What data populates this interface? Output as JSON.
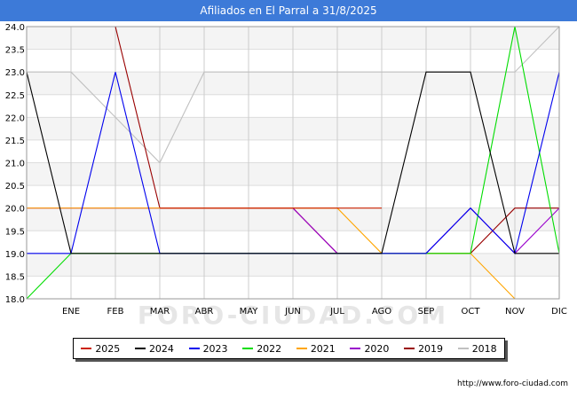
{
  "header": {
    "title": "Afiliados en El Parral a 31/8/2025"
  },
  "footer": {
    "source": "http://www.foro-ciudad.com"
  },
  "watermark": "FORO-CIUDAD.COM",
  "chart_data": {
    "type": "line",
    "title": "Afiliados en El Parral a 31/8/2025",
    "categories": [
      "",
      "ENE",
      "FEB",
      "MAR",
      "ABR",
      "MAY",
      "JUN",
      "JUL",
      "AGO",
      "SEP",
      "OCT",
      "NOV",
      "DIC"
    ],
    "ylim": [
      18.0,
      24.0
    ],
    "yticks": [
      "18.0",
      "18.5",
      "19.0",
      "19.5",
      "20.0",
      "20.5",
      "21.0",
      "21.5",
      "22.0",
      "22.5",
      "23.0",
      "23.5",
      "24.0"
    ],
    "grid": true,
    "legend_position": "bottom",
    "series": [
      {
        "name": "2025",
        "color": "#cc2200",
        "values": [
          null,
          null,
          null,
          20,
          20,
          20,
          20,
          20,
          20,
          null,
          null,
          null,
          null
        ]
      },
      {
        "name": "2024",
        "color": "#000000",
        "values": [
          23,
          19,
          19,
          19,
          19,
          19,
          19,
          19,
          19,
          23,
          23,
          19,
          19
        ]
      },
      {
        "name": "2023",
        "color": "#0000ee",
        "values": [
          19,
          19,
          23,
          19,
          19,
          19,
          19,
          19,
          19,
          19,
          20,
          19,
          23
        ]
      },
      {
        "name": "2022",
        "color": "#00dd00",
        "values": [
          18,
          19,
          19,
          19,
          19,
          19,
          19,
          19,
          19,
          19,
          19,
          24,
          19
        ]
      },
      {
        "name": "2021",
        "color": "#ffa500",
        "values": [
          20,
          20,
          20,
          20,
          20,
          20,
          20,
          20,
          19,
          19,
          19,
          18,
          null
        ]
      },
      {
        "name": "2020",
        "color": "#9900cc",
        "values": [
          20,
          20,
          20,
          20,
          20,
          20,
          20,
          19,
          19,
          19,
          20,
          19,
          20
        ]
      },
      {
        "name": "2019",
        "color": "#990000",
        "values": [
          null,
          null,
          24,
          20,
          20,
          20,
          20,
          19,
          19,
          19,
          19,
          20,
          20
        ]
      },
      {
        "name": "2018",
        "color": "#c0c0c0",
        "values": [
          23,
          23,
          22,
          21,
          23,
          23,
          23,
          23,
          23,
          23,
          23,
          23,
          24
        ]
      }
    ]
  }
}
